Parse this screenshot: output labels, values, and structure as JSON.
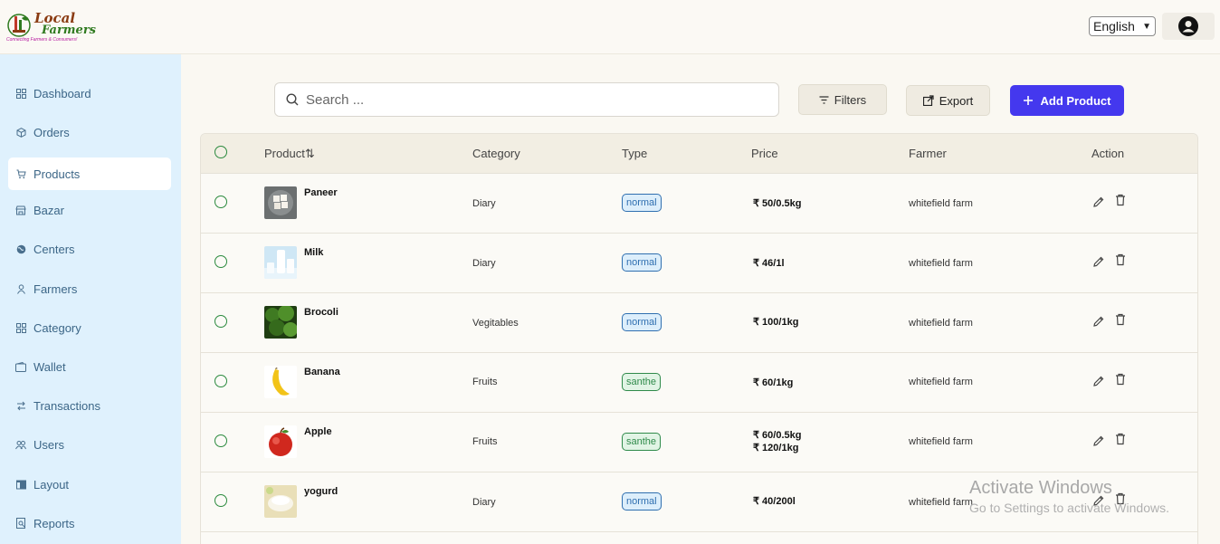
{
  "brand": {
    "line1": "Local",
    "line2": "Farmers",
    "tagline": "Connecting Farmers & Consumers!"
  },
  "header": {
    "language": "English"
  },
  "sidebar": {
    "items": [
      {
        "label": "Dashboard",
        "icon": "grid-icon"
      },
      {
        "label": "Orders",
        "icon": "box-icon"
      },
      {
        "label": "Products",
        "icon": "cart-icon",
        "active": true
      },
      {
        "label": "Bazar",
        "icon": "store-icon"
      },
      {
        "label": "Centers",
        "icon": "globe-icon"
      },
      {
        "label": "Farmers",
        "icon": "person-icon"
      },
      {
        "label": "Category",
        "icon": "grid-icon"
      },
      {
        "label": "Wallet",
        "icon": "wallet-icon"
      },
      {
        "label": "Transactions",
        "icon": "transfer-icon"
      },
      {
        "label": "Users",
        "icon": "users-icon"
      },
      {
        "label": "Layout",
        "icon": "layout-icon"
      },
      {
        "label": "Reports",
        "icon": "report-icon"
      }
    ]
  },
  "toolbar": {
    "search_placeholder": "Search ...",
    "filters_label": "Filters",
    "export_label": "Export",
    "add_label": "Add Product"
  },
  "table": {
    "headers": {
      "product": "Product",
      "category": "Category",
      "type": "Type",
      "price": "Price",
      "farmer": "Farmer",
      "action": "Action"
    },
    "rows": [
      {
        "name": "Paneer",
        "category": "Diary",
        "type": "normal",
        "price1": "₹ 50/0.5kg",
        "price2": "",
        "farmer": "whitefield farm"
      },
      {
        "name": "Milk",
        "category": "Diary",
        "type": "normal",
        "price1": "₹ 46/1l",
        "price2": "",
        "farmer": "whitefield farm"
      },
      {
        "name": "Brocoli",
        "category": "Vegitables",
        "type": "normal",
        "price1": "₹ 100/1kg",
        "price2": "",
        "farmer": "whitefield farm"
      },
      {
        "name": "Banana",
        "category": "Fruits",
        "type": "santhe",
        "price1": "₹ 60/1kg",
        "price2": "",
        "farmer": "whitefield farm"
      },
      {
        "name": "Apple",
        "category": "Fruits",
        "type": "santhe",
        "price1": "₹ 60/0.5kg",
        "price2": "₹ 120/1kg",
        "farmer": "whitefield farm"
      },
      {
        "name": "yogurd",
        "category": "Diary",
        "type": "normal",
        "price1": "₹ 40/200l",
        "price2": "",
        "farmer": "whitefield farm"
      }
    ]
  },
  "watermark": {
    "title": "Activate Windows",
    "subtitle": "Go to Settings to activate Windows."
  },
  "colors": {
    "accent": "#4438ee",
    "sidebar_bg": "#dff1fd",
    "normal_badge": "#2f6fb0",
    "santhe_badge": "#2f8a4a"
  }
}
